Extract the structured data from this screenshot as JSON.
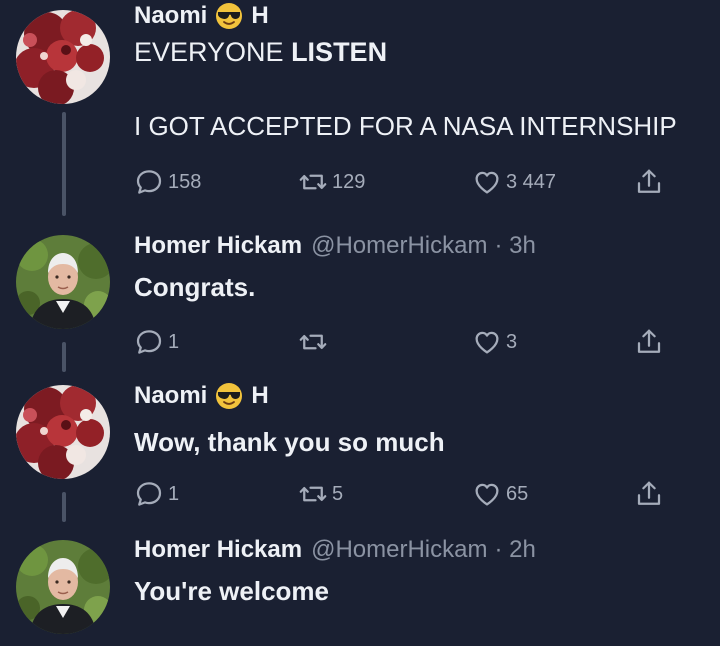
{
  "tweets": [
    {
      "name": "Naomi",
      "name_suffix": "H",
      "lines": [
        "EVERYONE LISTEN",
        "I GOT ACCEPTED FOR A NASA INTERNSHIP"
      ],
      "reply_count": "158",
      "retweet_count": "129",
      "like_count": "3 447"
    },
    {
      "name": "Homer Hickam",
      "handle": "@HomerHickam",
      "time": "· 3h",
      "text": "Congrats.",
      "reply_count": "1",
      "retweet_count": "",
      "like_count": "3"
    },
    {
      "name": "Naomi",
      "name_suffix": "H",
      "text": "Wow, thank you so much",
      "reply_count": "1",
      "retweet_count": "5",
      "like_count": "65"
    },
    {
      "name": "Homer Hickam",
      "handle": "@HomerHickam",
      "time": "· 2h",
      "text": "You're welcome"
    }
  ],
  "icons": {
    "reply": "reply-icon",
    "retweet": "retweet-icon",
    "like": "heart-icon",
    "share": "share-icon",
    "emoji": "sunglasses-emoji-icon"
  },
  "colors": {
    "background": "#1a2032",
    "text": "#eef1f6",
    "muted": "#8b93a3",
    "action": "#a5acba"
  }
}
